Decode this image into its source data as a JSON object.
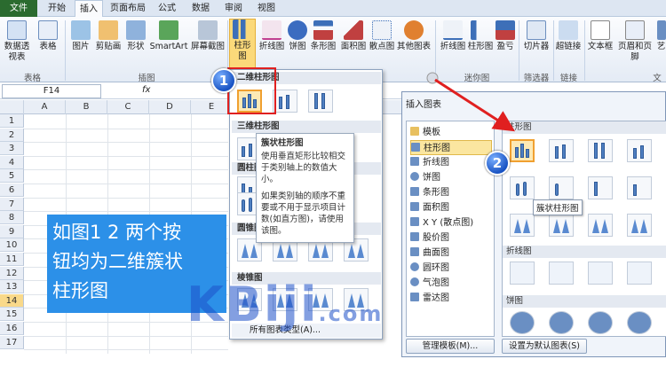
{
  "ribbon_tabs": [
    "文件",
    "开始",
    "插入",
    "页面布局",
    "公式",
    "数据",
    "审阅",
    "视图"
  ],
  "ribbon_buttons": [
    "数据透视表",
    "表格",
    "图片",
    "剪贴画",
    "形状",
    "SmartArt",
    "屏幕截图",
    "柱形图",
    "折线图",
    "饼图",
    "条形图",
    "面积图",
    "散点图",
    "其他图表",
    "折线图",
    "柱形图",
    "盈亏",
    "切片器",
    "超链接",
    "文本框",
    "页眉和页脚",
    "艺"
  ],
  "ribbon_groups": [
    "表格",
    "插图",
    "迷你图",
    "筛选器",
    "链接",
    "文"
  ],
  "formula_bar": {
    "name_box": "F14",
    "fx": "fx"
  },
  "columns": [
    "A",
    "B",
    "C",
    "D",
    "E"
  ],
  "rows": [
    "1",
    "2",
    "3",
    "4",
    "5",
    "6",
    "7",
    "8",
    "9",
    "10",
    "11",
    "12",
    "13",
    "14",
    "15",
    "16",
    "17"
  ],
  "dropdown": {
    "sections": [
      "二维柱形图",
      "三维柱形图",
      "圆柱图",
      "圆锥图",
      "棱锥图"
    ],
    "all_types": "所有图表类型(A)..."
  },
  "tooltip": {
    "title": "簇状柱形图",
    "line1": "使用垂直矩形比较相交于类别轴上的数值大小。",
    "line2": "如果类别轴的顺序不重要或不用于显示项目计数(如直方图)，请使用该图。"
  },
  "dialog": {
    "title": "插入图表",
    "list": [
      "模板",
      "柱形图",
      "折线图",
      "饼图",
      "条形图",
      "面积图",
      "X Y (散点图)",
      "股价图",
      "曲面图",
      "圆环图",
      "气泡图",
      "雷达图"
    ],
    "selected": "柱形图",
    "sections": [
      "柱形图",
      "折线图",
      "饼图"
    ],
    "tooltip": "簇状柱形图",
    "manage_btn": "管理模板(M)...",
    "default_btn": "设置为默认图表(S)"
  },
  "callouts": [
    "1",
    "2"
  ],
  "banner": {
    "line1": "如图1 2 两个按",
    "line2": "钮均为二维簇状",
    "line3": "柱形图"
  },
  "watermark": {
    "main": "KBiji",
    "suffix": ".com"
  },
  "colors": {
    "accent": "#2c90e8",
    "file_tab": "#2b6b2f",
    "highlight": "#e02020"
  }
}
